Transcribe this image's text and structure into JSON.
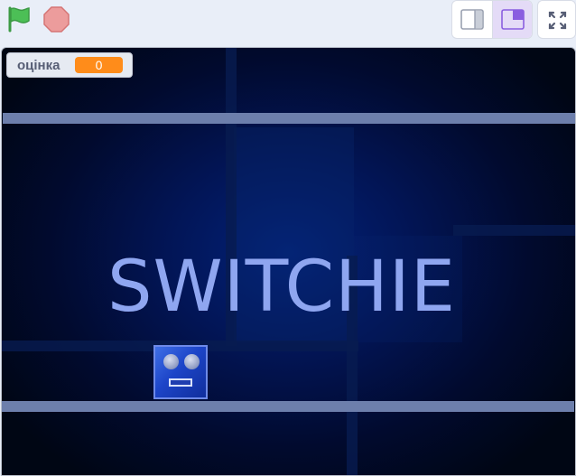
{
  "toolbar": {
    "green_flag_icon": "green-flag-icon",
    "stop_icon": "stop-sign-icon",
    "layout_small_icon": "small-stage-icon",
    "layout_normal_icon": "normal-stage-icon",
    "fullscreen_icon": "fullscreen-icon",
    "active_layout": "normal"
  },
  "stage": {
    "title": "SWITCHIE",
    "score_monitor": {
      "label": "оцінка",
      "value": "0"
    }
  },
  "colors": {
    "flag_green": "#4cbf56",
    "stop_red": "#ec9c9c",
    "monitor_orange": "#ff8c1a",
    "layout_active_bg": "#e4dbf7",
    "title_text": "#8fa6f0",
    "platform": "#6d7fac",
    "player_blue": "#1d45c8"
  }
}
